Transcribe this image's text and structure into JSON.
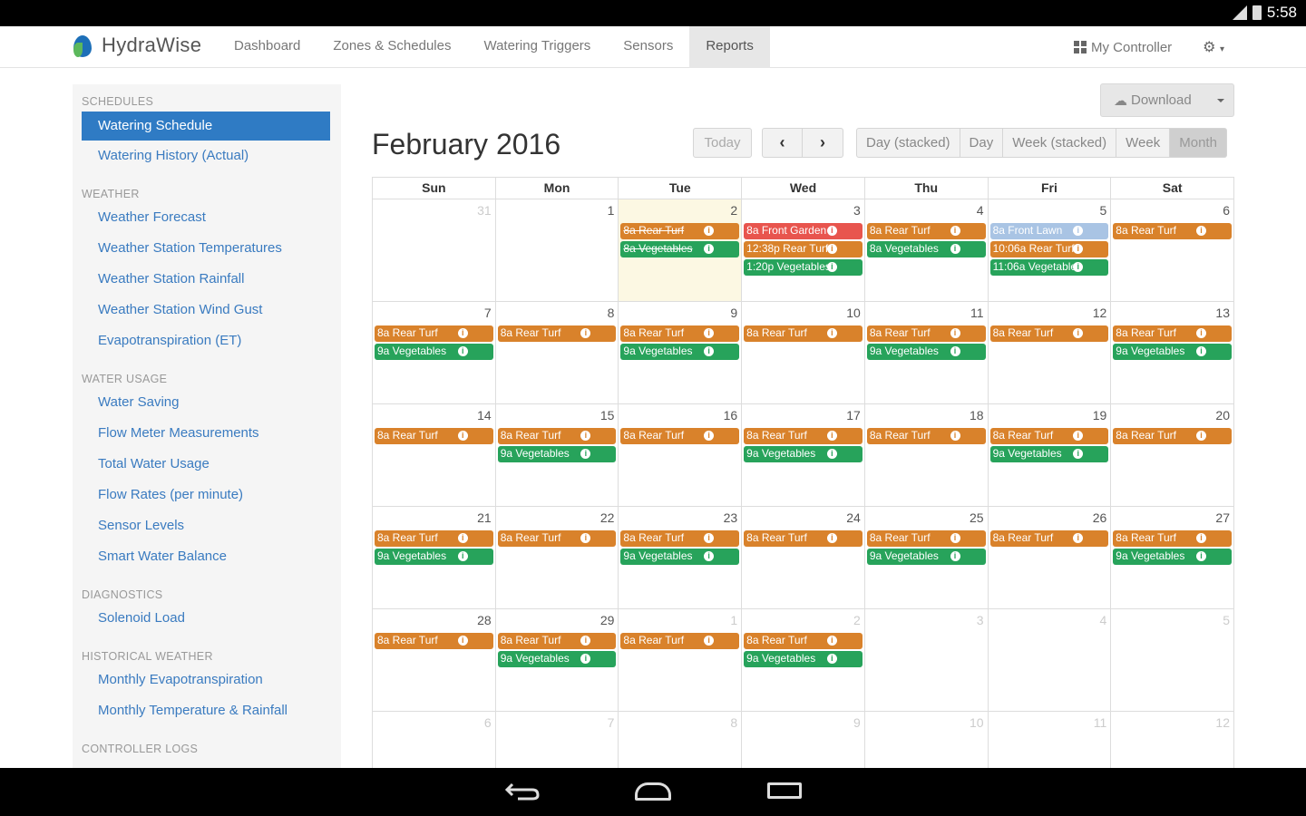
{
  "status": {
    "time": "5:58"
  },
  "nav": {
    "brand": "HydraWise",
    "items": [
      {
        "label": "Dashboard",
        "active": false
      },
      {
        "label": "Zones & Schedules",
        "active": false
      },
      {
        "label": "Watering Triggers",
        "active": false
      },
      {
        "label": "Sensors",
        "active": false
      },
      {
        "label": "Reports",
        "active": true
      }
    ],
    "controller": "My Controller"
  },
  "sidebar": {
    "sections": [
      {
        "title": "SCHEDULES",
        "links": [
          {
            "label": "Watering Schedule",
            "active": true
          },
          {
            "label": "Watering History (Actual)"
          }
        ]
      },
      {
        "title": "WEATHER",
        "links": [
          {
            "label": "Weather Forecast"
          },
          {
            "label": "Weather Station Temperatures"
          },
          {
            "label": "Weather Station Rainfall"
          },
          {
            "label": "Weather Station Wind Gust"
          },
          {
            "label": "Evapotranspiration (ET)"
          }
        ]
      },
      {
        "title": "WATER USAGE",
        "links": [
          {
            "label": "Water Saving"
          },
          {
            "label": "Flow Meter Measurements"
          },
          {
            "label": "Total Water Usage"
          },
          {
            "label": "Flow Rates (per minute)"
          },
          {
            "label": "Sensor Levels"
          },
          {
            "label": "Smart Water Balance"
          }
        ]
      },
      {
        "title": "DIAGNOSTICS",
        "links": [
          {
            "label": "Solenoid Load"
          }
        ]
      },
      {
        "title": "HISTORICAL WEATHER",
        "links": [
          {
            "label": "Monthly Evapotranspiration"
          },
          {
            "label": "Monthly Temperature & Rainfall"
          }
        ]
      },
      {
        "title": "CONTROLLER LOGS",
        "links": []
      }
    ]
  },
  "toolbar": {
    "download": "Download",
    "title": "February 2016",
    "today": "Today",
    "prev": "‹",
    "next": "›",
    "views": [
      {
        "label": "Day (stacked)",
        "active": false
      },
      {
        "label": "Day",
        "active": false
      },
      {
        "label": "Week (stacked)",
        "active": false
      },
      {
        "label": "Week",
        "active": false
      },
      {
        "label": "Month",
        "active": true
      }
    ]
  },
  "calendar": {
    "weekdays": [
      "Sun",
      "Mon",
      "Tue",
      "Wed",
      "Thu",
      "Fri",
      "Sat"
    ],
    "weeks": [
      [
        {
          "num": "31",
          "other": true,
          "events": []
        },
        {
          "num": "1",
          "events": []
        },
        {
          "num": "2",
          "today": true,
          "events": [
            {
              "label": "8a Rear Turf",
              "type": "turf",
              "struck": true
            },
            {
              "label": "8a Vegetables",
              "type": "veg",
              "struck": true
            }
          ]
        },
        {
          "num": "3",
          "events": [
            {
              "label": "8a Front Garden",
              "type": "front"
            },
            {
              "label": "12:38p Rear Turf",
              "type": "turf"
            },
            {
              "label": "1:20p Vegetables",
              "type": "veg"
            }
          ]
        },
        {
          "num": "4",
          "events": [
            {
              "label": "8a Rear Turf",
              "type": "turf"
            },
            {
              "label": "8a Vegetables",
              "type": "veg"
            }
          ]
        },
        {
          "num": "5",
          "events": [
            {
              "label": "8a Front Lawn",
              "type": "lawn"
            },
            {
              "label": "10:06a Rear Turf",
              "type": "turf"
            },
            {
              "label": "11:06a Vegetables",
              "type": "veg"
            }
          ]
        },
        {
          "num": "6",
          "events": [
            {
              "label": "8a Rear Turf",
              "type": "turf"
            }
          ]
        }
      ],
      [
        {
          "num": "7",
          "events": [
            {
              "label": "8a Rear Turf",
              "type": "turf"
            },
            {
              "label": "9a Vegetables",
              "type": "veg"
            }
          ]
        },
        {
          "num": "8",
          "events": [
            {
              "label": "8a Rear Turf",
              "type": "turf"
            }
          ]
        },
        {
          "num": "9",
          "events": [
            {
              "label": "8a Rear Turf",
              "type": "turf"
            },
            {
              "label": "9a Vegetables",
              "type": "veg"
            }
          ]
        },
        {
          "num": "10",
          "events": [
            {
              "label": "8a Rear Turf",
              "type": "turf"
            }
          ]
        },
        {
          "num": "11",
          "events": [
            {
              "label": "8a Rear Turf",
              "type": "turf"
            },
            {
              "label": "9a Vegetables",
              "type": "veg"
            }
          ]
        },
        {
          "num": "12",
          "events": [
            {
              "label": "8a Rear Turf",
              "type": "turf"
            }
          ]
        },
        {
          "num": "13",
          "events": [
            {
              "label": "8a Rear Turf",
              "type": "turf"
            },
            {
              "label": "9a Vegetables",
              "type": "veg"
            }
          ]
        }
      ],
      [
        {
          "num": "14",
          "events": [
            {
              "label": "8a Rear Turf",
              "type": "turf"
            }
          ]
        },
        {
          "num": "15",
          "events": [
            {
              "label": "8a Rear Turf",
              "type": "turf"
            },
            {
              "label": "9a Vegetables",
              "type": "veg"
            }
          ]
        },
        {
          "num": "16",
          "events": [
            {
              "label": "8a Rear Turf",
              "type": "turf"
            }
          ]
        },
        {
          "num": "17",
          "events": [
            {
              "label": "8a Rear Turf",
              "type": "turf"
            },
            {
              "label": "9a Vegetables",
              "type": "veg"
            }
          ]
        },
        {
          "num": "18",
          "events": [
            {
              "label": "8a Rear Turf",
              "type": "turf"
            }
          ]
        },
        {
          "num": "19",
          "events": [
            {
              "label": "8a Rear Turf",
              "type": "turf"
            },
            {
              "label": "9a Vegetables",
              "type": "veg"
            }
          ]
        },
        {
          "num": "20",
          "events": [
            {
              "label": "8a Rear Turf",
              "type": "turf"
            }
          ]
        }
      ],
      [
        {
          "num": "21",
          "events": [
            {
              "label": "8a Rear Turf",
              "type": "turf"
            },
            {
              "label": "9a Vegetables",
              "type": "veg"
            }
          ]
        },
        {
          "num": "22",
          "events": [
            {
              "label": "8a Rear Turf",
              "type": "turf"
            }
          ]
        },
        {
          "num": "23",
          "events": [
            {
              "label": "8a Rear Turf",
              "type": "turf"
            },
            {
              "label": "9a Vegetables",
              "type": "veg"
            }
          ]
        },
        {
          "num": "24",
          "events": [
            {
              "label": "8a Rear Turf",
              "type": "turf"
            }
          ]
        },
        {
          "num": "25",
          "events": [
            {
              "label": "8a Rear Turf",
              "type": "turf"
            },
            {
              "label": "9a Vegetables",
              "type": "veg"
            }
          ]
        },
        {
          "num": "26",
          "events": [
            {
              "label": "8a Rear Turf",
              "type": "turf"
            }
          ]
        },
        {
          "num": "27",
          "events": [
            {
              "label": "8a Rear Turf",
              "type": "turf"
            },
            {
              "label": "9a Vegetables",
              "type": "veg"
            }
          ]
        }
      ],
      [
        {
          "num": "28",
          "events": [
            {
              "label": "8a Rear Turf",
              "type": "turf"
            }
          ]
        },
        {
          "num": "29",
          "events": [
            {
              "label": "8a Rear Turf",
              "type": "turf"
            },
            {
              "label": "9a Vegetables",
              "type": "veg"
            }
          ]
        },
        {
          "num": "1",
          "other": true,
          "events": [
            {
              "label": "8a Rear Turf",
              "type": "turf"
            }
          ]
        },
        {
          "num": "2",
          "other": true,
          "events": [
            {
              "label": "8a Rear Turf",
              "type": "turf"
            },
            {
              "label": "9a Vegetables",
              "type": "veg"
            }
          ]
        },
        {
          "num": "3",
          "other": true,
          "events": []
        },
        {
          "num": "4",
          "other": true,
          "events": []
        },
        {
          "num": "5",
          "other": true,
          "events": []
        }
      ],
      [
        {
          "num": "6",
          "other": true,
          "events": []
        },
        {
          "num": "7",
          "other": true,
          "events": []
        },
        {
          "num": "8",
          "other": true,
          "events": []
        },
        {
          "num": "9",
          "other": true,
          "events": []
        },
        {
          "num": "10",
          "other": true,
          "events": []
        },
        {
          "num": "11",
          "other": true,
          "events": []
        },
        {
          "num": "12",
          "other": true,
          "events": []
        }
      ]
    ]
  },
  "colors": {
    "turf": "#d9822b",
    "vegetables": "#27a35b",
    "front_garden": "#e8554e",
    "front_lawn": "#a9c4e4",
    "accent": "#2f7bc4"
  }
}
